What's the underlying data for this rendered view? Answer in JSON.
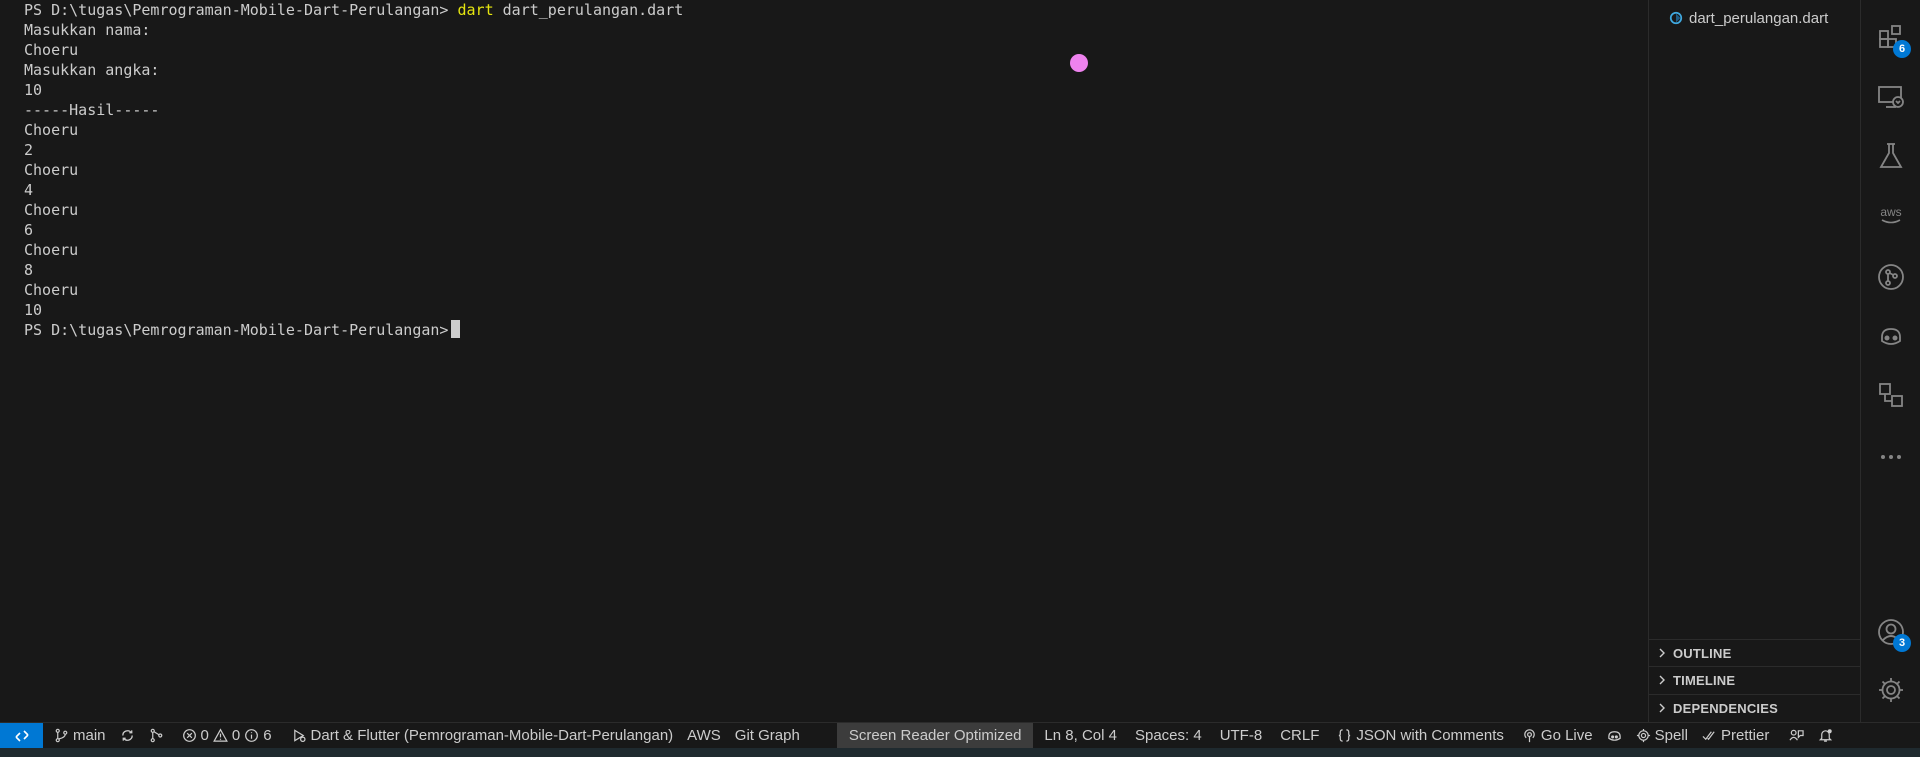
{
  "terminal": {
    "prompt": "PS D:\\tugas\\Pemrograman-Mobile-Dart-Perulangan>",
    "command_word": "dart",
    "command_arg": "dart_perulangan.dart",
    "lines": [
      "Masukkan nama:",
      "Choeru",
      "Masukkan angka:",
      "10",
      "-----Hasil-----",
      "Choeru",
      "2",
      "Choeru",
      "4",
      "Choeru",
      "6",
      "Choeru",
      "8",
      "Choeru",
      "10"
    ],
    "final_prompt": "PS D:\\tugas\\Pemrograman-Mobile-Dart-Perulangan>"
  },
  "side_panel": {
    "open_file": "dart_perulangan.dart",
    "sections": [
      "OUTLINE",
      "TIMELINE",
      "DEPENDENCIES"
    ]
  },
  "activity_bar": {
    "extensions_badge": "6",
    "accounts_badge": "3",
    "icons": [
      "extensions-icon",
      "remote-explorer-icon",
      "testing-icon",
      "aws-icon",
      "git-graph-icon",
      "copilot-icon",
      "references-icon",
      "more-icon",
      "accounts-icon",
      "settings-gear-icon"
    ]
  },
  "status_bar": {
    "branch": "main",
    "errors": "0",
    "warnings": "0",
    "infos": "6",
    "debug_config": "Dart & Flutter (Pemrograman-Mobile-Dart-Perulangan)",
    "aws": "AWS",
    "git_graph": "Git Graph",
    "screen_reader": "Screen Reader Optimized",
    "cursor_pos": "Ln 8, Col 4",
    "spaces": "Spaces: 4",
    "encoding": "UTF-8",
    "eol": "CRLF",
    "language": "JSON with Comments",
    "go_live": "Go Live",
    "spell": "Spell",
    "prettier": "Prettier"
  },
  "colors": {
    "accent": "#0078d4",
    "command": "#e5e510",
    "mouse_dot": "#ee82ee"
  }
}
